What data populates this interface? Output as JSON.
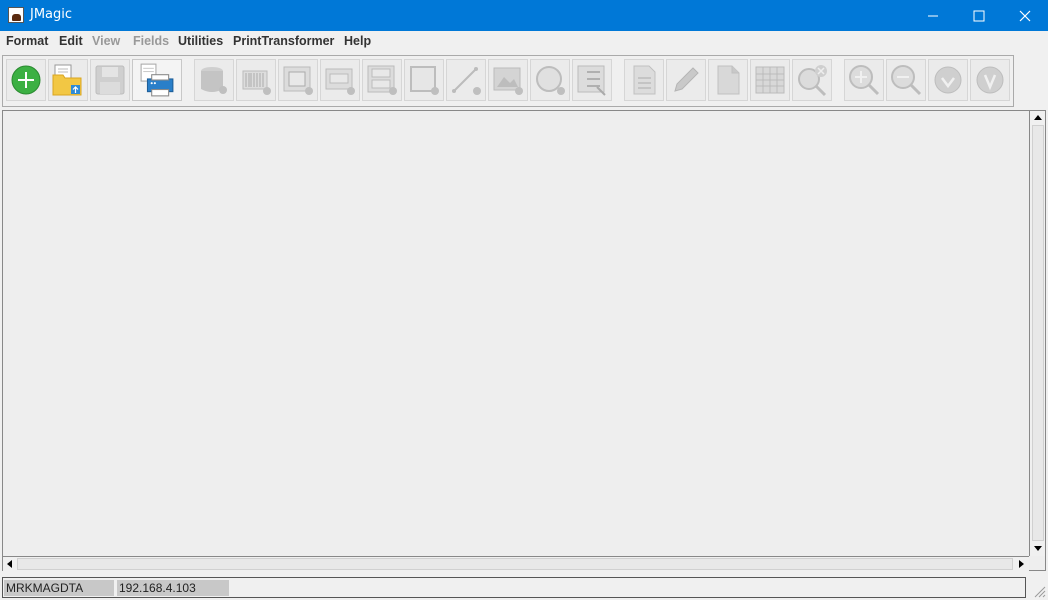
{
  "window": {
    "title": "JMagic"
  },
  "menu": [
    {
      "label": "Format",
      "disabled": false
    },
    {
      "label": "Edit",
      "disabled": false
    },
    {
      "label": "View",
      "disabled": true
    },
    {
      "label": "Fields",
      "disabled": true
    },
    {
      "label": "Utilities",
      "disabled": false
    },
    {
      "label": "PrintTransformer",
      "disabled": false
    },
    {
      "label": "Help",
      "disabled": false
    }
  ],
  "toolbar": {
    "buttons": [
      {
        "icon": "add-icon",
        "enabled": true
      },
      {
        "icon": "open-folder-icon",
        "enabled": true
      },
      {
        "icon": "save-disk-icon",
        "enabled": false
      },
      {
        "icon": "printer-icon",
        "enabled": true
      },
      {
        "icon": "database-icon",
        "enabled": false
      },
      {
        "icon": "barcode-icon",
        "enabled": false
      },
      {
        "icon": "image-frame-icon",
        "enabled": false
      },
      {
        "icon": "text-field-icon",
        "enabled": false
      },
      {
        "icon": "multi-text-icon",
        "enabled": false
      },
      {
        "icon": "rectangle-icon",
        "enabled": false
      },
      {
        "icon": "line-icon",
        "enabled": false
      },
      {
        "icon": "picture-icon",
        "enabled": false
      },
      {
        "icon": "circle-icon",
        "enabled": false
      },
      {
        "icon": "checklist-icon",
        "enabled": false
      },
      {
        "icon": "document-list-icon",
        "enabled": false
      },
      {
        "icon": "pencil-icon",
        "enabled": false
      },
      {
        "icon": "blank-page-icon",
        "enabled": false
      },
      {
        "icon": "grid-icon",
        "enabled": false
      },
      {
        "icon": "search-remove-icon",
        "enabled": false
      },
      {
        "icon": "zoom-in-icon",
        "enabled": false
      },
      {
        "icon": "zoom-out-icon",
        "enabled": false
      },
      {
        "icon": "arrow-down-circle-icon",
        "enabled": false
      },
      {
        "icon": "arrow-down-alt-icon",
        "enabled": false
      }
    ]
  },
  "status": {
    "library": "MRKMAGDTA",
    "host": "192.168.4.103"
  },
  "colors": {
    "titlebar": "#0078d7",
    "add_green": "#3cb043",
    "folder_yellow": "#f2c744",
    "disabled_gray": "#c4c4c4"
  }
}
